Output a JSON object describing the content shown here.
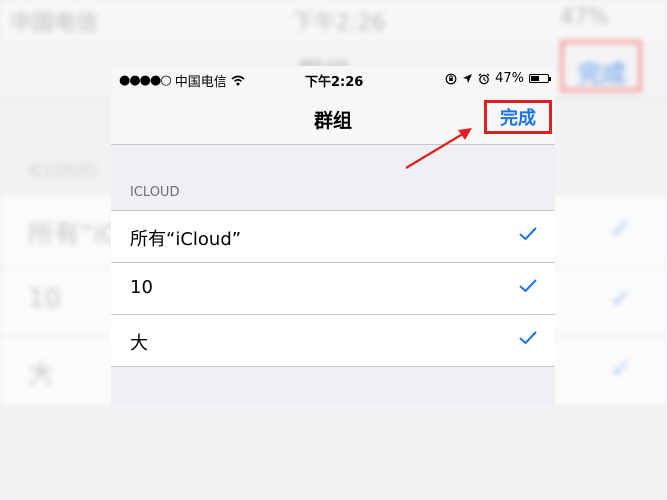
{
  "status_bar": {
    "signal": "●●●●○",
    "carrier": "中国电信",
    "time": "下午2:26",
    "battery": "47%",
    "battery_level": 0.47
  },
  "nav": {
    "title": "群组",
    "done_label": "完成"
  },
  "section": {
    "header": "ICLOUD"
  },
  "rows": [
    {
      "label": "所有“iCloud”",
      "checked": true
    },
    {
      "label": "10",
      "checked": true
    },
    {
      "label": "大",
      "checked": true
    }
  ],
  "colors": {
    "accent": "#1a73e8",
    "annotation": "#e02020",
    "background": "#efeff4"
  },
  "icons": [
    "wifi-icon",
    "lock-rotation-icon",
    "location-icon",
    "alarm-icon",
    "battery-icon",
    "checkmark-icon",
    "annotation-arrow"
  ]
}
